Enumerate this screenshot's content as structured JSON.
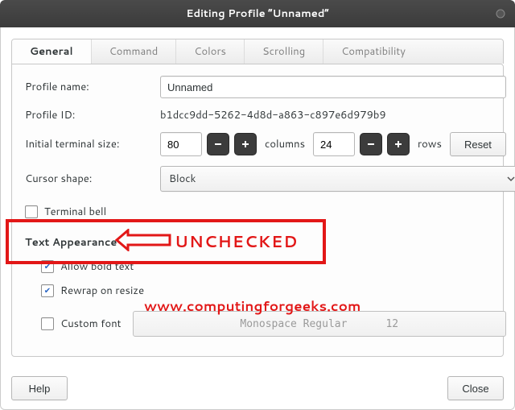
{
  "title": "Editing Profile “Unnamed”",
  "tabs": {
    "general": "General",
    "command": "Command",
    "colors": "Colors",
    "scrolling": "Scrolling",
    "compatibility": "Compatibility"
  },
  "labels": {
    "profile_name": "Profile name:",
    "profile_id": "Profile ID:",
    "initial_size": "Initial terminal size:",
    "cursor_shape": "Cursor shape:",
    "columns": "columns",
    "rows": "rows",
    "reset": "Reset",
    "terminal_bell": "Terminal bell",
    "text_appearance": "Text Appearance",
    "allow_bold": "Allow bold text",
    "rewrap": "Rewrap on resize",
    "custom_font": "Custom font",
    "help": "Help",
    "close": "Close"
  },
  "values": {
    "profile_name": "Unnamed",
    "profile_id": "b1dcc9dd-5262-4d8d-a863-c897e6d979b9",
    "columns": "80",
    "rows": "24",
    "cursor_shape": "Block",
    "font_name": "Monospace Regular",
    "font_size": "12"
  },
  "annotation": {
    "unchecked": "UNCHECKED",
    "url": "www.computingforgeeks.com"
  }
}
